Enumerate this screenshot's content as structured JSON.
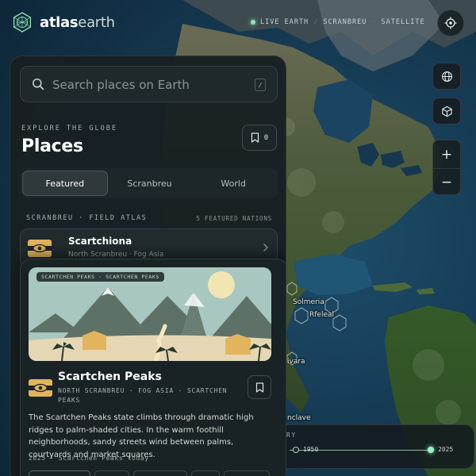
{
  "app": {
    "brand_bold": "atlas",
    "brand_light": "earth",
    "status": {
      "live": "LIVE EARTH",
      "sep1": "/",
      "region": "SCRANBREU",
      "dot": "·",
      "mode": "SATELLITE"
    }
  },
  "map": {
    "labels": {
      "solmeria": "Solmeria",
      "rfeleal": "Rfeleal",
      "ivara": "ivara",
      "enclave": "nclave"
    }
  },
  "timeline": {
    "label": "RY",
    "start_year": "1950",
    "end_year": "2025",
    "progress": 1.0
  },
  "panel": {
    "search": {
      "placeholder": "Search places on Earth",
      "kbd": "/",
      "value": ""
    },
    "eyebrow": "EXPLORE THE GLOBE",
    "title": "Places",
    "saved_count": "0",
    "tabs": [
      {
        "label": "Featured",
        "active": true
      },
      {
        "label": "Scranbreu",
        "active": false
      },
      {
        "label": "World",
        "active": false
      }
    ],
    "section": {
      "left": "SCRANBREU · FIELD ATLAS",
      "right": "5 FEATURED NATIONS"
    },
    "list": [
      {
        "title": "Scartchiona",
        "subtitle": "North Scranbreu · Fog Asia"
      }
    ],
    "detail": {
      "image_tag": "SCARTCHEN PEAKS · SCARTCHEN PEAKS",
      "title": "Scartchen Peaks",
      "meta": "NORTH SCRANBREU · FOG ASIA · SCARTCHEN PEAKS",
      "description": "The Scartchen Peaks state climbs through dramatic high ridges to palm-shaded cities. In the warm foothill neighborhoods, sandy streets wind between palms, courtyards and market squares.",
      "footer": "2025 · Scartchen Peaks today"
    }
  },
  "colors": {
    "accent": "#8ee6b3",
    "panel": "#181f22",
    "flag_gold": "#e2b45c"
  },
  "icons": [
    "logo-globe-icon",
    "locate-icon",
    "globe-icon",
    "cube-icon",
    "plus-icon",
    "minus-icon",
    "search-icon",
    "bookmark-icon",
    "chevron-right-icon",
    "eye-flag-icon"
  ]
}
